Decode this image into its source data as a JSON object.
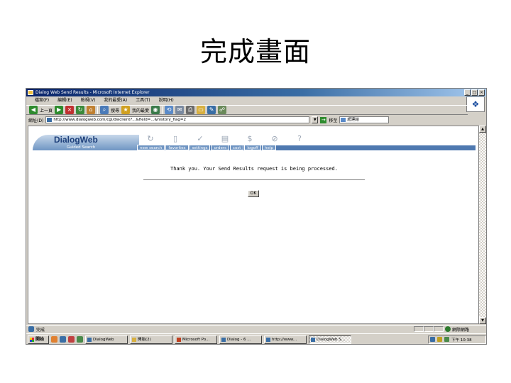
{
  "slide": {
    "title": "完成畫面"
  },
  "window": {
    "title": "Dialog Web Send Results - Microsoft Internet Explorer",
    "menu": [
      "檔案(F)",
      "編輯(E)",
      "檢視(V)",
      "我的最愛(A)",
      "工具(T)",
      "說明(H)"
    ]
  },
  "toolbar": {
    "back_label": "上一頁",
    "search_label": "搜尋",
    "favorites_label": "我的最愛"
  },
  "address": {
    "label": "網址(D)",
    "url": "http://www.dialogweb.com/cgi/dwclient?...&field=...&history_flag=2",
    "go_label": "移至",
    "links_label": "超連結"
  },
  "dialogweb": {
    "logo": "DialogWeb",
    "tagline": "Guided Search",
    "tabs": [
      "new search",
      "favorites",
      "settings",
      "orders",
      "cost",
      "logoff",
      "help"
    ]
  },
  "content": {
    "message": "Thank you. Your Send Results request is being processed.",
    "ok_label": "OK"
  },
  "status": {
    "left_text": "完成",
    "zone_text": "網際網路"
  },
  "taskbar": {
    "start_label": "開始",
    "tasks": [
      "DialogWeb",
      "開始(2)",
      "Microsoft Po...",
      "Dialog - 6 ...",
      "http://www...",
      "DialogWeb S..."
    ],
    "clock": "下午 10:38"
  }
}
